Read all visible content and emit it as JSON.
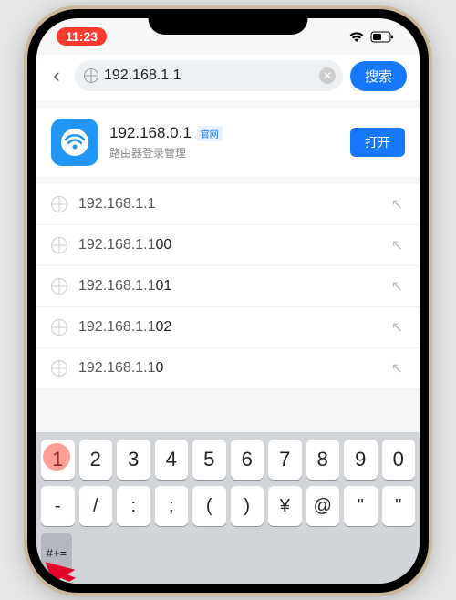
{
  "status": {
    "time": "11:23"
  },
  "search": {
    "value": "192.168.1.1",
    "button": "搜索"
  },
  "app": {
    "title": "192.168.0.1",
    "badge": "官网",
    "subtitle": "路由器登录管理",
    "open": "打开"
  },
  "suggestions": [
    {
      "prefix": "192.168.1.1",
      "suffix": ""
    },
    {
      "prefix": "192.168.1.1",
      "suffix": "00"
    },
    {
      "prefix": "192.168.1.1",
      "suffix": "01"
    },
    {
      "prefix": "192.168.1.1",
      "suffix": "02"
    },
    {
      "prefix": "192.168.1.1",
      "suffix": "0"
    }
  ],
  "keys_row1": [
    "1",
    "2",
    "3",
    "4",
    "5",
    "6",
    "7",
    "8",
    "9",
    "0"
  ],
  "keys_row2": [
    "-",
    "/",
    ":",
    ";",
    "(",
    ")",
    "¥",
    "@",
    "\"",
    "\""
  ],
  "mode_key": "#+="
}
